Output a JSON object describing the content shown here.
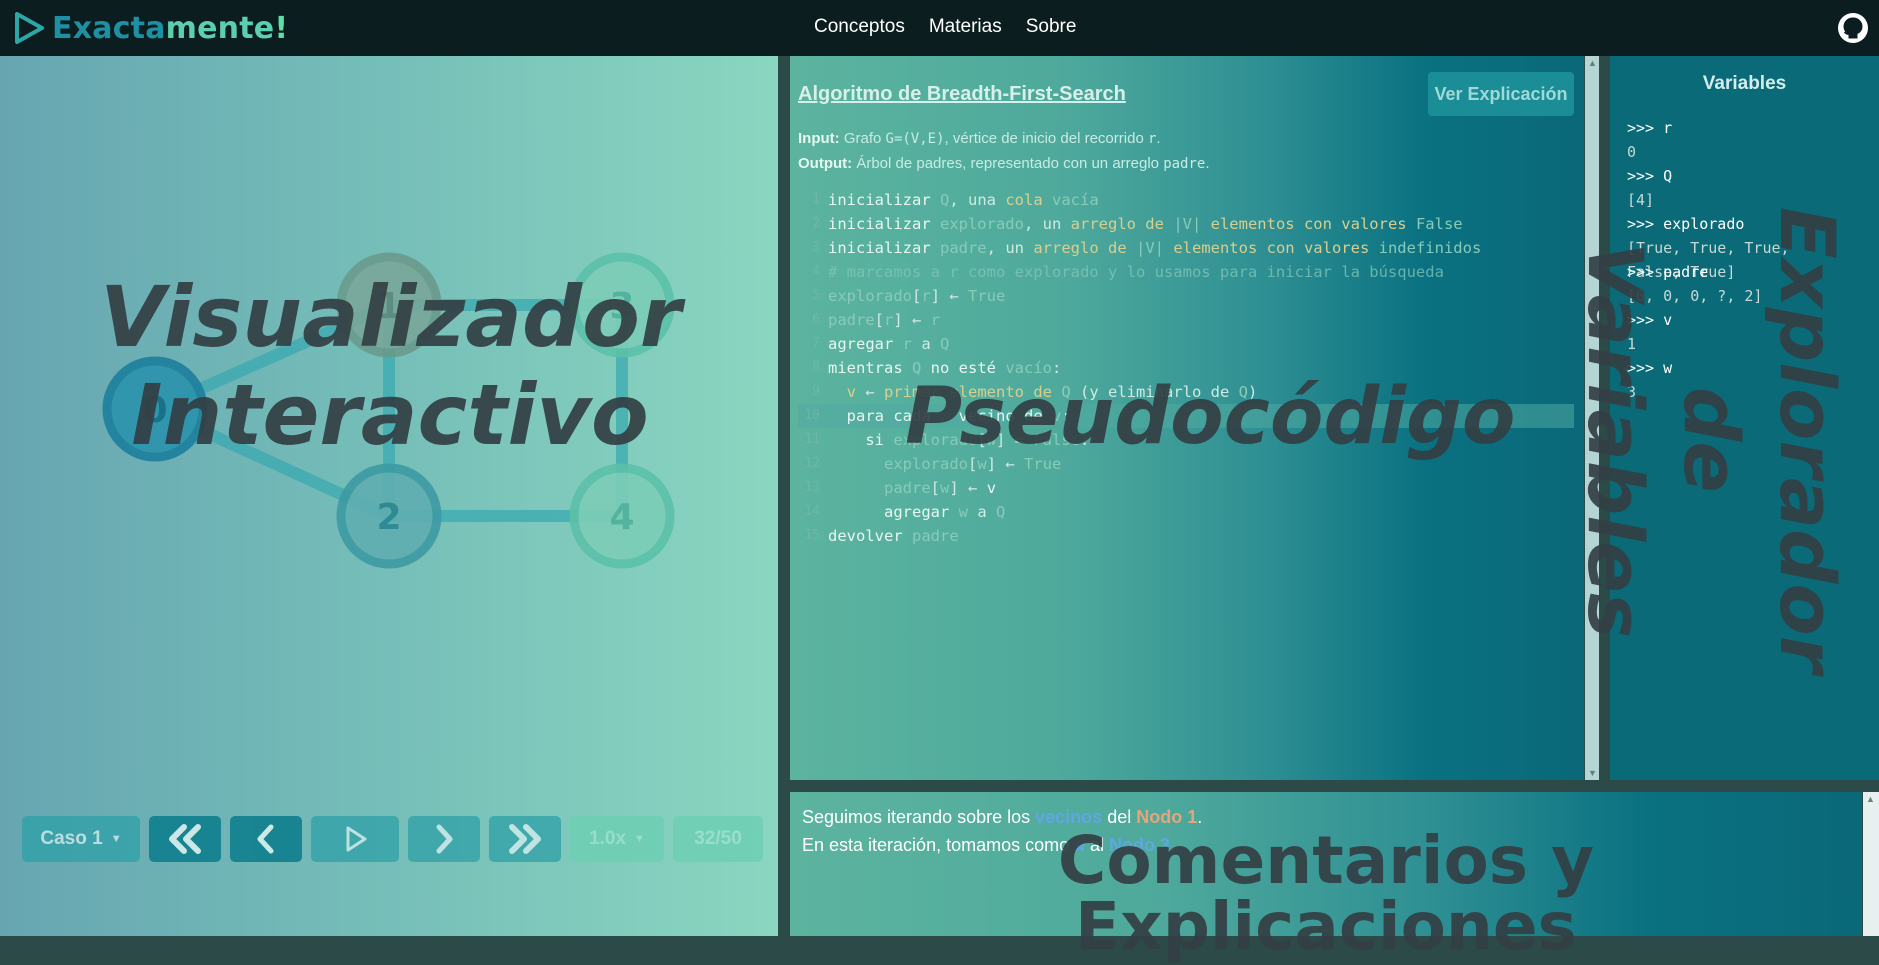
{
  "navbar": {
    "logo_part1": "Exacta",
    "logo_part2": "mente",
    "logo_part3": "!",
    "links": [
      "Conceptos",
      "Materias",
      "Sobre"
    ]
  },
  "visualizer": {
    "overlay_label_line1": "Visualizador",
    "overlay_label_line2": "Interactivo",
    "nodes": [
      {
        "id": "0",
        "state": "current"
      },
      {
        "id": "1",
        "state": "visited"
      },
      {
        "id": "2",
        "state": "queued"
      },
      {
        "id": "3",
        "state": "unvisited"
      },
      {
        "id": "4",
        "state": "unvisited"
      }
    ],
    "controls": {
      "case_label": "Caso 1",
      "speed_label": "1.0x",
      "step_counter": "32/50"
    }
  },
  "pseudocode": {
    "title": "Algoritmo de Breadth-First-Search",
    "explain_button": "Ver Explicación",
    "input_label": "Input:",
    "input_text_1": "Grafo",
    "input_code_1": "G=(V,E)",
    "input_text_2": ", vértice de inicio del recorrido",
    "input_code_2": "r",
    "input_text_3": ".",
    "output_label": "Output:",
    "output_text_1": "Árbol de padres, representado con un arreglo",
    "output_code_1": "padre",
    "output_text_2": ".",
    "overlay_label": "Pseudocódigo",
    "highlighted_line": 10
  },
  "variables": {
    "title": "Variables",
    "entries": [
      {
        "prompt": ">>> r",
        "value": "0"
      },
      {
        "prompt": ">>> Q",
        "value": "[4]"
      },
      {
        "prompt": ">>> explorado",
        "value": "[True, True, True,\nFalse, True]"
      },
      {
        "prompt": ">>> padre",
        "value": "[0, 0, 0, ?, 2]"
      },
      {
        "prompt": ">>> v",
        "value": "1"
      },
      {
        "prompt": ">>> w",
        "value": "3"
      }
    ],
    "overlay_label_line1": "Explorador",
    "overlay_label_line2": "de Variables"
  },
  "comments": {
    "line1_text1": "Seguimos iterando sobre los",
    "line1_link1": "vecinos",
    "line1_text2": "del",
    "line1_link2": "Nodo 1",
    "line1_text3": ".",
    "line2_text1": "En esta iteración, tomamos como",
    "line2_var": "w",
    "line2_text2": "al",
    "line2_link": "Nodo 3",
    "line2_text3": ".",
    "overlay_label": "Comentarios y Explicaciones"
  },
  "colors": {
    "navbar_bg": "#0b1d1f",
    "accent_blue": "#1f8fa4",
    "accent_green": "#5ccfb0",
    "highlight_blue": "#5fa7e2",
    "highlight_orange": "#e6a57a"
  }
}
